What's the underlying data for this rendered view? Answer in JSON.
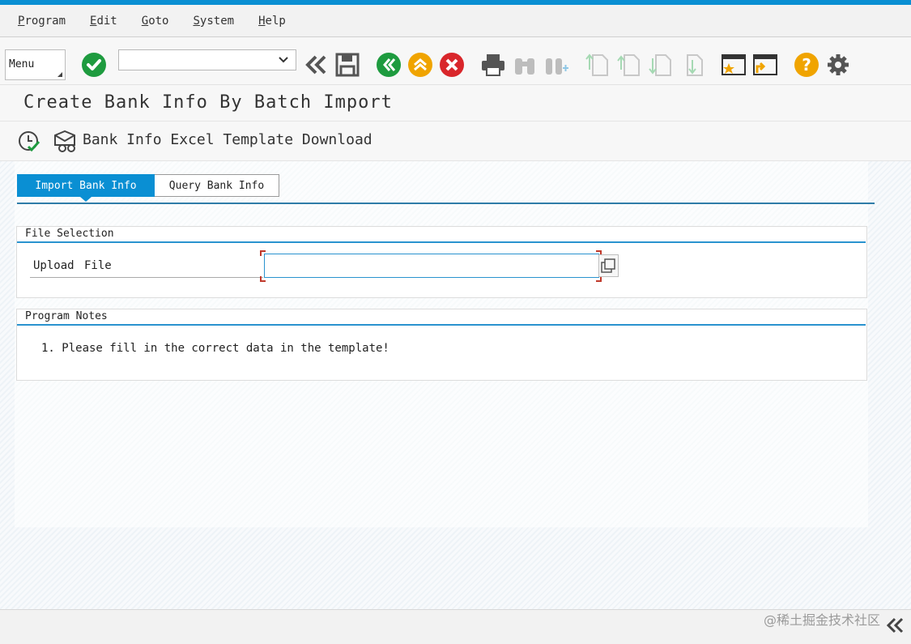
{
  "menubar": {
    "items": [
      {
        "label": "Program"
      },
      {
        "label": "Edit"
      },
      {
        "label": "Goto"
      },
      {
        "label": "System"
      },
      {
        "label": "Help"
      }
    ]
  },
  "toolbar": {
    "menu_label": "Menu",
    "command_value": ""
  },
  "title": "Create Bank Info By Batch Import",
  "app_toolbar": {
    "template_download_label": "Bank Info Excel Template Download"
  },
  "tabs": [
    {
      "label": "Import Bank Info",
      "active": true
    },
    {
      "label": "Query Bank Info",
      "active": false
    }
  ],
  "file_selection": {
    "title": "File Selection",
    "upload_label": "Upload File",
    "file_value": ""
  },
  "program_notes": {
    "title": "Program Notes",
    "note": "1. Please fill in the correct data in the template!"
  },
  "watermark": "@稀土掘金技术社区",
  "colors": {
    "accent": "#0a8fd3",
    "green": "#1e9b3f",
    "orange": "#f0a400",
    "red": "#d9262b"
  }
}
